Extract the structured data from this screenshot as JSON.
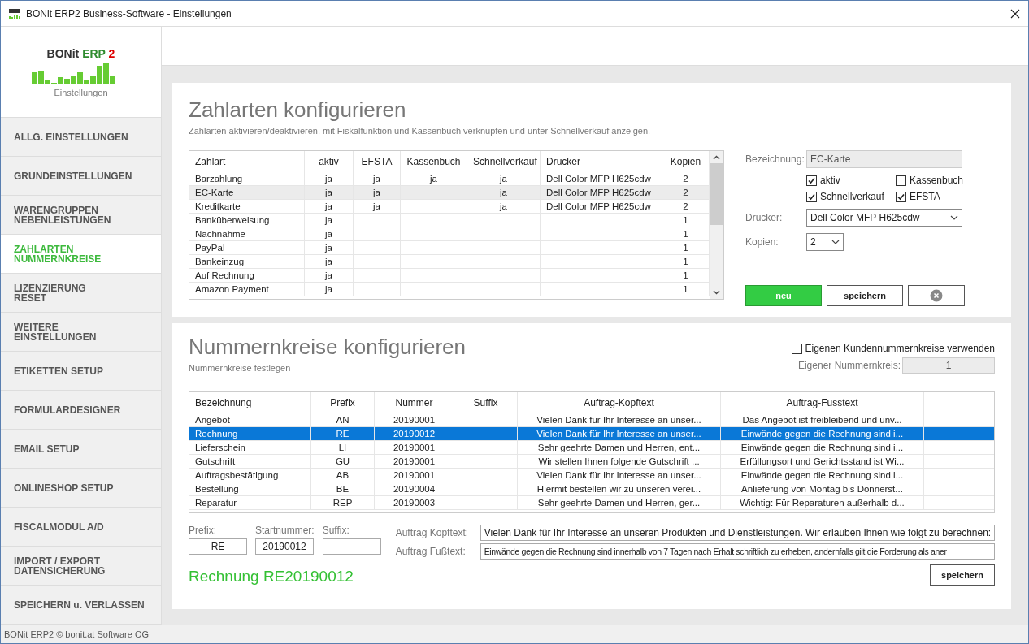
{
  "window": {
    "title": "BONit ERP2 Business-Software - Einstellungen"
  },
  "logo": {
    "name": "BONit",
    "product": "ERP",
    "version": "2",
    "subtitle": "Einstellungen"
  },
  "sidebar": {
    "items": [
      {
        "label": "ALLG. EINSTELLUNGEN",
        "selected": false
      },
      {
        "label": "GRUNDEINSTELLUNGEN",
        "selected": false
      },
      {
        "label": "WARENGRUPPEN\nNEBENLEISTUNGEN",
        "selected": false
      },
      {
        "label": "ZAHLARTEN\nNUMMERNKREISE",
        "selected": true
      },
      {
        "label": "LIZENZIERUNG\nRESET",
        "selected": false
      },
      {
        "label": "WEITERE\nEINSTELLUNGEN",
        "selected": false
      },
      {
        "label": "ETIKETTEN SETUP",
        "selected": false
      },
      {
        "label": "FORMULARDESIGNER",
        "selected": false
      },
      {
        "label": "EMAIL SETUP",
        "selected": false
      },
      {
        "label": "ONLINESHOP SETUP",
        "selected": false
      },
      {
        "label": "FISCALMODUL A/D",
        "selected": false
      },
      {
        "label": "IMPORT / EXPORT\nDATENSICHERUNG",
        "selected": false
      },
      {
        "label": "SPEICHERN u. VERLASSEN",
        "selected": false
      }
    ]
  },
  "payments": {
    "title": "Zahlarten konfigurieren",
    "subtitle": "Zahlarten aktivieren/deaktivieren, mit Fiskalfunktion und Kassenbuch verknüpfen und unter Schnellverkauf anzeigen.",
    "table": {
      "columns": [
        "Zahlart",
        "aktiv",
        "EFSTA",
        "Kassenbuch",
        "Schnellverkauf",
        "Drucker",
        "Kopien"
      ],
      "rows": [
        {
          "cells": [
            "Barzahlung",
            "ja",
            "ja",
            "ja",
            "ja",
            "Dell Color MFP H625cdw",
            "2"
          ],
          "selected": false
        },
        {
          "cells": [
            "EC-Karte",
            "ja",
            "ja",
            null,
            "ja",
            "Dell Color MFP H625cdw",
            "2"
          ],
          "selected": true
        },
        {
          "cells": [
            "Kreditkarte",
            "ja",
            "ja",
            null,
            "ja",
            "Dell Color MFP H625cdw",
            "2"
          ],
          "selected": false
        },
        {
          "cells": [
            "Banküberweisung",
            "ja",
            null,
            null,
            null,
            null,
            "1"
          ],
          "selected": false
        },
        {
          "cells": [
            "Nachnahme",
            "ja",
            null,
            null,
            null,
            null,
            "1"
          ],
          "selected": false
        },
        {
          "cells": [
            "PayPal",
            "ja",
            null,
            null,
            null,
            null,
            "1"
          ],
          "selected": false
        },
        {
          "cells": [
            "Bankeinzug",
            "ja",
            null,
            null,
            null,
            null,
            "1"
          ],
          "selected": false
        },
        {
          "cells": [
            "Auf Rechnung",
            "ja",
            null,
            null,
            null,
            null,
            "1"
          ],
          "selected": false
        },
        {
          "cells": [
            "Amazon Payment",
            "ja",
            null,
            null,
            null,
            null,
            "1"
          ],
          "selected": false
        }
      ]
    },
    "form": {
      "name_label": "Bezeichnung:",
      "name_value": "EC-Karte",
      "checkboxes": [
        {
          "label": "aktiv",
          "checked": true
        },
        {
          "label": "Kassenbuch",
          "checked": false
        },
        {
          "label": "Schnellverkauf",
          "checked": true
        },
        {
          "label": "EFSTA",
          "checked": true
        }
      ],
      "printer_label": "Drucker:",
      "printer_value": "Dell Color MFP H625cdw",
      "copies_label": "Kopien:",
      "copies_value": "2"
    },
    "buttons": [
      {
        "kind": "new",
        "label": "neu"
      },
      {
        "kind": "save",
        "label": "speichern"
      },
      {
        "kind": "cancel"
      }
    ]
  },
  "numbers": {
    "title": "Nummernkreise konfigurieren",
    "subtitle": "Nummernkreise festlegen",
    "own_circle": {
      "label": "Eigenen Kundennummernkreise verwenden",
      "checked": false
    },
    "own_number_label": "Eigener Nummernkreis:",
    "own_number_value": "1",
    "table": {
      "columns": [
        "Bezeichnung",
        "Prefix",
        "Nummer",
        "Suffix",
        "Auftrag-Kopftext",
        "Auftrag-Fusstext"
      ],
      "rows": [
        {
          "cells": [
            "Angebot",
            "AN",
            "20190001",
            null,
            "Vielen Dank für Ihr Interesse an unser...",
            "Das Angebot ist freibleibend und unv..."
          ],
          "selected": false
        },
        {
          "cells": [
            "Rechnung",
            "RE",
            "20190012",
            null,
            "Vielen Dank für Ihr Interesse an unser...",
            "Einwände gegen die Rechnung sind i..."
          ],
          "selected": true
        },
        {
          "cells": [
            "Lieferschein",
            "LI",
            "20190001",
            null,
            "Sehr geehrte Damen und Herren, ent...",
            "Einwände gegen die Rechnung sind i..."
          ],
          "selected": false
        },
        {
          "cells": [
            "Gutschrift",
            "GU",
            "20190001",
            null,
            "Wir stellen Ihnen folgende Gutschrift ...",
            "Erfüllungsort und Gerichtsstand ist Wi..."
          ],
          "selected": false
        },
        {
          "cells": [
            "Auftragsbestätigung",
            "AB",
            "20190001",
            null,
            "Vielen Dank für Ihr Interesse an unser...",
            "Einwände gegen die Rechnung sind i..."
          ],
          "selected": false
        },
        {
          "cells": [
            "Bestellung",
            "BE",
            "20190004",
            null,
            "Hiermit bestellen wir zu unseren verei...",
            "Anlieferung von Montag bis Donnerst..."
          ],
          "selected": false
        },
        {
          "cells": [
            "Reparatur",
            "REP",
            "20190003",
            null,
            "Sehr geehrte Damen und Herren, ger...",
            "Wichtig: Für Reparaturen außerhalb d..."
          ],
          "selected": false
        }
      ]
    },
    "form": {
      "prefix_label": "Prefix:",
      "prefix_value": "RE",
      "start_label": "Startnummer:",
      "start_value": "20190012",
      "suffix_label": "Suffix:",
      "head_label": "Auftrag Kopftext:",
      "head_value": "Vielen Dank für Ihr Interesse an unseren Produkten und Dienstleistungen. Wir erlauben Ihnen wie folgt zu berechnen:",
      "foot_label": "Auftrag Fußtext:",
      "foot_value": "Einwände gegen die Rechnung sind innerhalb von 7 Tagen nach Erhalt schriftlich zu erheben, andernfalls gilt die Forderung als aner"
    },
    "preview": "Rechnung RE20190012",
    "save_label": "speichern"
  },
  "status_bar": "BONit ERP2 © bonit.at Software OG"
}
